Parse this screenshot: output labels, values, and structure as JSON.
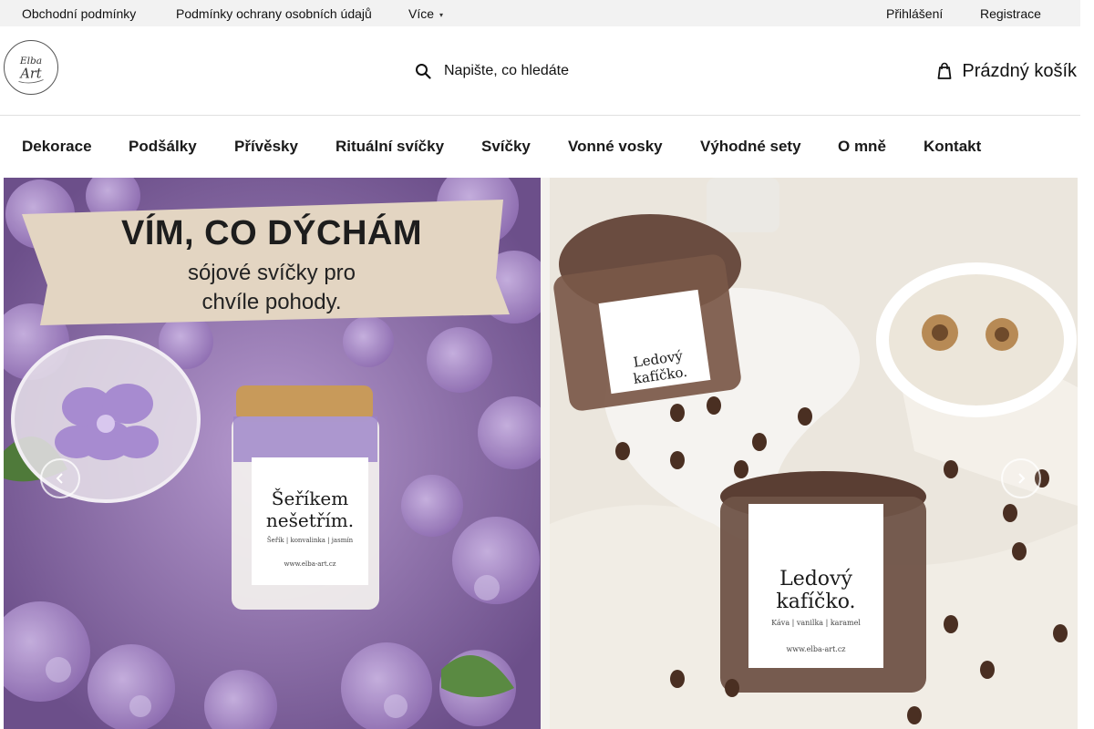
{
  "topbar": {
    "links": [
      {
        "label": "Obchodní podmínky"
      },
      {
        "label": "Podmínky ochrany osobních údajů"
      },
      {
        "label": "Více"
      }
    ],
    "login_label": "Přihlášení",
    "register_label": "Registrace"
  },
  "header": {
    "logo_text_line1": "Elba",
    "logo_text_line2": "Art",
    "search_placeholder": "Napište, co hledáte",
    "cart_label": "Prázdný košík"
  },
  "nav": {
    "items": [
      {
        "label": "Dekorace"
      },
      {
        "label": "Podšálky"
      },
      {
        "label": "Přívěsky"
      },
      {
        "label": "Rituální svíčky"
      },
      {
        "label": "Svíčky"
      },
      {
        "label": "Vonné vosky"
      },
      {
        "label": "Výhodné sety"
      },
      {
        "label": "O mně"
      },
      {
        "label": "Kontakt"
      }
    ]
  },
  "hero": {
    "banner_line1": "VÍM, CO DÝCHÁM",
    "banner_line2": "sójové svíčky pro",
    "banner_line3": "chvíle pohody.",
    "left_jar_label1": "Šeříkem",
    "left_jar_label2": "nešetřím.",
    "left_jar_sub": "Šeřík | konvalinka | jasmín",
    "left_jar_url": "www.elba-art.cz",
    "right_jar_top_label1": "Ledový",
    "right_jar_top_label2": "kafíčko.",
    "right_jar_label1": "Ledový",
    "right_jar_label2": "kafíčko.",
    "right_jar_sub": "Káva | vanilka | karamel",
    "right_jar_url": "www.elba-art.cz"
  },
  "colors": {
    "topbar_bg": "#f2f2f2",
    "lilac": "#8a6aa8",
    "cream": "#ece8e0",
    "text": "#111111"
  },
  "icons": {
    "search": "search-icon",
    "cart": "cart-icon",
    "dropdown": "caret-down-icon",
    "prev": "chevron-left-icon",
    "next": "chevron-right-icon"
  }
}
